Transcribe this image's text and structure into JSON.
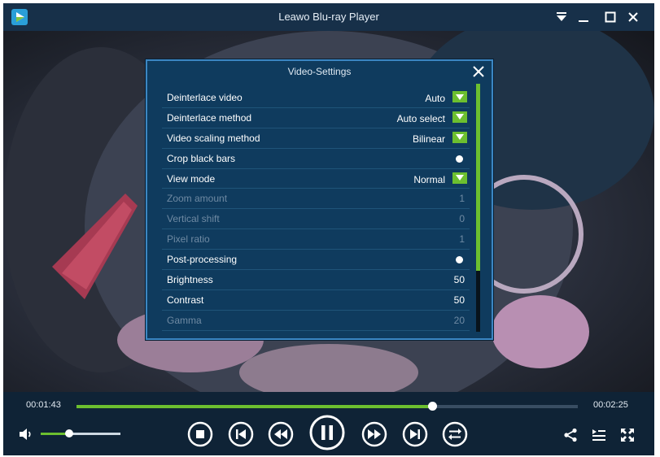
{
  "window": {
    "title": "Leawo Blu-ray Player"
  },
  "dialog": {
    "title": "Video-Settings",
    "rows": [
      {
        "label": "Deinterlace video",
        "value": "Auto",
        "kind": "dropdown",
        "enabled": true
      },
      {
        "label": "Deinterlace method",
        "value": "Auto select",
        "kind": "dropdown",
        "enabled": true
      },
      {
        "label": "Video scaling method",
        "value": "Bilinear",
        "kind": "dropdown",
        "enabled": true
      },
      {
        "label": "Crop black bars",
        "value": "",
        "kind": "toggle",
        "enabled": true
      },
      {
        "label": "View mode",
        "value": "Normal",
        "kind": "dropdown",
        "enabled": true
      },
      {
        "label": "Zoom amount",
        "value": "1",
        "kind": "number",
        "enabled": false
      },
      {
        "label": "Vertical shift",
        "value": "0",
        "kind": "number",
        "enabled": false
      },
      {
        "label": "Pixel ratio",
        "value": "1",
        "kind": "number",
        "enabled": false
      },
      {
        "label": "Post-processing",
        "value": "",
        "kind": "toggle",
        "enabled": true
      },
      {
        "label": "Brightness",
        "value": "50",
        "kind": "number",
        "enabled": true
      },
      {
        "label": "Contrast",
        "value": "50",
        "kind": "number",
        "enabled": true
      },
      {
        "label": "Gamma",
        "value": "20",
        "kind": "number",
        "enabled": false
      }
    ]
  },
  "player": {
    "elapsed": "00:01:43",
    "duration": "00:02:25",
    "progress": 0.71,
    "volume": 0.36
  },
  "colors": {
    "accent": "#6cbf2f",
    "dialog_bg": "#0f3b5e",
    "dialog_border": "#3b86c3",
    "bar_bg": "#0f2336"
  },
  "icons": {
    "title_bar": [
      "app-logo-icon",
      "menu-dropdown-icon",
      "minimize-icon",
      "maximize-icon",
      "close-icon"
    ],
    "controls": [
      "volume-icon",
      "stop-icon",
      "previous-icon",
      "rewind-icon",
      "pause-icon",
      "fast-forward-icon",
      "next-icon",
      "repeat-icon",
      "share-icon",
      "playlist-icon",
      "fullscreen-icon"
    ]
  }
}
